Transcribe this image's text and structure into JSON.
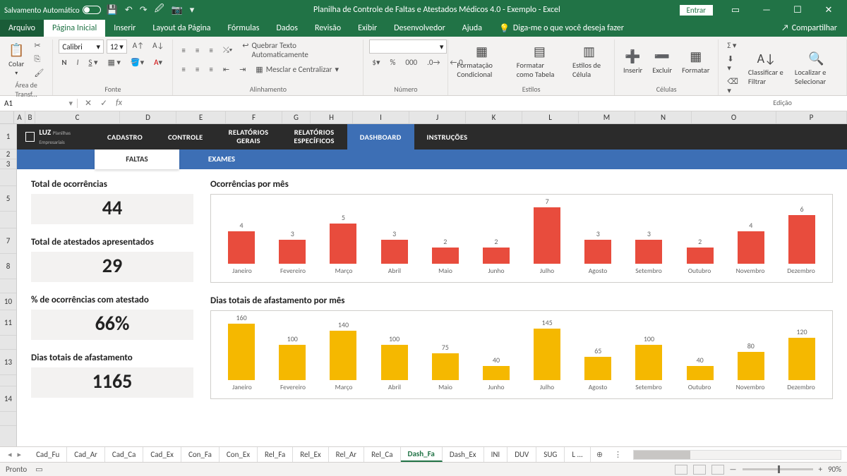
{
  "titlebar": {
    "auto_save": "Salvamento Automático",
    "title": "Planilha de Controle de Faltas e Atestados Médicos 4.0 - Exemplo  -  Excel",
    "signin": "Entrar"
  },
  "menu": [
    "Arquivo",
    "Página Inicial",
    "Inserir",
    "Layout da Página",
    "Fórmulas",
    "Dados",
    "Revisão",
    "Exibir",
    "Desenvolvedor",
    "Ajuda"
  ],
  "tellme": "Diga-me o que você deseja fazer",
  "share": "Compartilhar",
  "ribbon": {
    "paste": "Colar",
    "clipboard_label": "Área de Transf...",
    "font_name": "Calibri",
    "font_size": "12",
    "font_label": "Fonte",
    "wrap": "Quebrar Texto Automaticamente",
    "merge": "Mesclar e Centralizar",
    "align_label": "Alinhamento",
    "number_label": "Número",
    "cond": "Formatação Condicional",
    "table": "Formatar como Tabela",
    "cellstyle": "Estilos de Célula",
    "styles_label": "Estilos",
    "insert": "Inserir",
    "delete": "Excluir",
    "format": "Formatar",
    "cells_label": "Células",
    "sort": "Classificar e Filtrar",
    "find": "Localizar e Selecionar",
    "edit_label": "Edição"
  },
  "namebox": "A1",
  "columns": [
    "A",
    "B",
    "C",
    "D",
    "E",
    "F",
    "G",
    "H",
    "I",
    "J",
    "K",
    "L",
    "M",
    "N",
    "O",
    "P"
  ],
  "rownums": [
    "1",
    "2",
    "3",
    "",
    "5",
    "",
    "7",
    "8",
    "",
    "10",
    "11",
    "",
    "13",
    "",
    "14",
    ""
  ],
  "nav": {
    "logo_main": "LUZ",
    "logo_sub": "Planilhas Empresariais",
    "tabs": [
      "CADASTRO",
      "CONTROLE",
      "RELATÓRIOS GERAIS",
      "RELATÓRIOS ESPECÍFICOS",
      "DASHBOARD",
      "INSTRUÇÕES"
    ],
    "subtabs": [
      "FALTAS",
      "EXAMES"
    ]
  },
  "metrics": [
    {
      "title": "Total de ocorrências",
      "value": "44"
    },
    {
      "title": "Total de atestados apresentados",
      "value": "29"
    },
    {
      "title": "% de ocorrências com atestado",
      "value": "66%"
    },
    {
      "title": "Dias totais de afastamento",
      "value": "1165"
    }
  ],
  "chart_data": [
    {
      "type": "bar",
      "title": "Ocorrências por mês",
      "categories": [
        "Janeiro",
        "Fevereiro",
        "Março",
        "Abril",
        "Maio",
        "Junho",
        "Julho",
        "Agosto",
        "Setembro",
        "Outubro",
        "Novembro",
        "Dezembro"
      ],
      "values": [
        4,
        3,
        5,
        3,
        2,
        2,
        7,
        3,
        3,
        2,
        4,
        6
      ],
      "ylim": [
        0,
        7
      ],
      "color": "#e84c3d"
    },
    {
      "type": "bar",
      "title": "Dias totais de afastamento por mês",
      "categories": [
        "Janeiro",
        "Fevereiro",
        "Março",
        "Abril",
        "Maio",
        "Junho",
        "Julho",
        "Agosto",
        "Setembro",
        "Outubro",
        "Novembro",
        "Dezembro"
      ],
      "values": [
        160,
        100,
        140,
        100,
        75,
        40,
        145,
        65,
        100,
        40,
        80,
        120
      ],
      "ylim": [
        0,
        160
      ],
      "color": "#f5b800"
    }
  ],
  "sheet_tabs": [
    "Cad_Fu",
    "Cad_Ar",
    "Cad_Ca",
    "Cad_Ex",
    "Con_Fa",
    "Con_Ex",
    "Rel_Fa",
    "Rel_Ex",
    "Rel_Ar",
    "Rel_Ca",
    "Dash_Fa",
    "Dash_Ex",
    "INI",
    "DUV",
    "SUG",
    "L  ..."
  ],
  "active_sheet": "Dash_Fa",
  "status": {
    "ready": "Pronto",
    "zoom": "90%"
  }
}
